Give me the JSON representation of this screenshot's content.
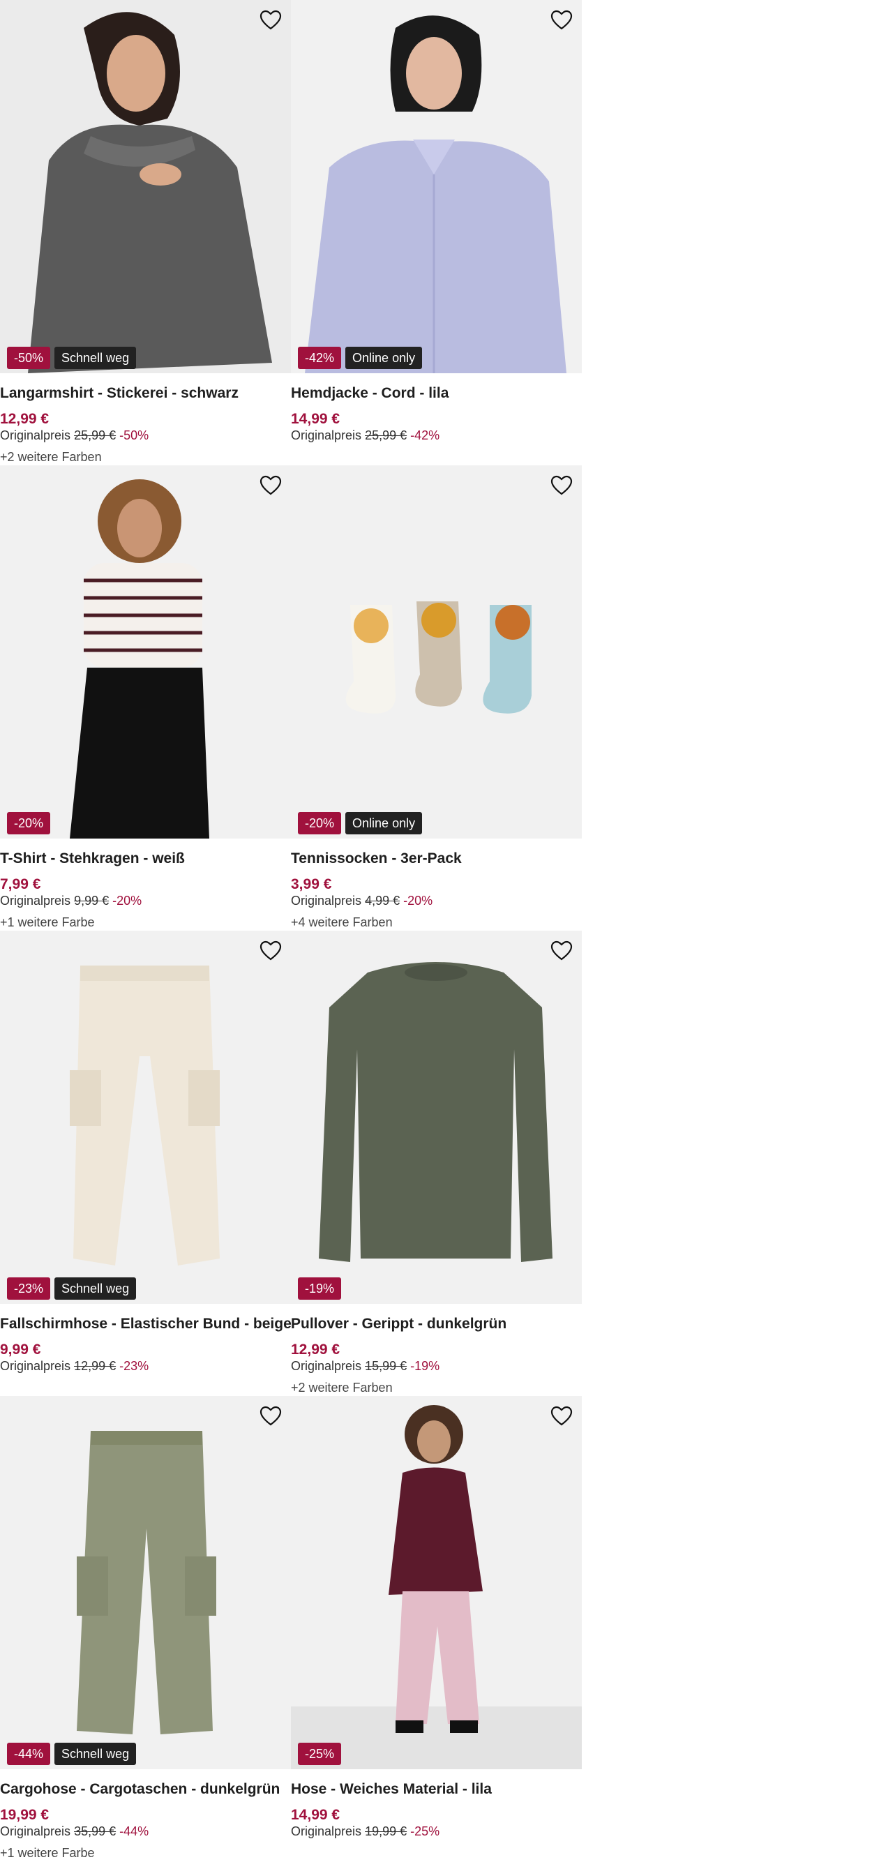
{
  "colors": {
    "accent": "#a0113d",
    "tag_bg": "#222222",
    "image_bg": "#f1f1f1"
  },
  "products": [
    {
      "name": "Langarmshirt - Stickerei - schwarz",
      "price": "12,99 €",
      "orig_label": "Originalpreis",
      "orig_price": "25,99 €",
      "discount": "-50%",
      "tag": "Schnell weg",
      "more_colors": "+2 weitere Farben",
      "favorite_icon": "heart-outline-icon"
    },
    {
      "name": "Hemdjacke - Cord - lila",
      "price": "14,99 €",
      "orig_label": "Originalpreis",
      "orig_price": "25,99 €",
      "discount": "-42%",
      "tag": "Online only",
      "more_colors": "",
      "favorite_icon": "heart-outline-icon"
    },
    {
      "name": "T-Shirt - Stehkragen - weiß",
      "price": "7,99 €",
      "orig_label": "Originalpreis",
      "orig_price": "9,99 €",
      "discount": "-20%",
      "tag": "",
      "more_colors": "+1 weitere Farbe",
      "favorite_icon": "heart-outline-icon"
    },
    {
      "name": "Tennissocken - 3er-Pack",
      "price": "3,99 €",
      "orig_label": "Originalpreis",
      "orig_price": "4,99 €",
      "discount": "-20%",
      "tag": "Online only",
      "more_colors": "+4 weitere Farben",
      "favorite_icon": "heart-outline-icon"
    },
    {
      "name": "Fallschirmhose - Elastischer Bund - beige",
      "price": "9,99 €",
      "orig_label": "Originalpreis",
      "orig_price": "12,99 €",
      "discount": "-23%",
      "tag": "Schnell weg",
      "more_colors": "",
      "favorite_icon": "heart-outline-icon"
    },
    {
      "name": "Pullover - Gerippt - dunkelgrün",
      "price": "12,99 €",
      "orig_label": "Originalpreis",
      "orig_price": "15,99 €",
      "discount": "-19%",
      "tag": "",
      "more_colors": "+2 weitere Farben",
      "favorite_icon": "heart-outline-icon"
    },
    {
      "name": "Cargohose - Cargotaschen - dunkelgrün",
      "price": "19,99 €",
      "orig_label": "Originalpreis",
      "orig_price": "35,99 €",
      "discount": "-44%",
      "tag": "Schnell weg",
      "more_colors": "+1 weitere Farbe",
      "favorite_icon": "heart-outline-icon"
    },
    {
      "name": "Hose - Weiches Material - lila",
      "price": "14,99 €",
      "orig_label": "Originalpreis",
      "orig_price": "19,99 €",
      "discount": "-25%",
      "tag": "",
      "more_colors": "",
      "favorite_icon": "heart-outline-icon"
    }
  ]
}
